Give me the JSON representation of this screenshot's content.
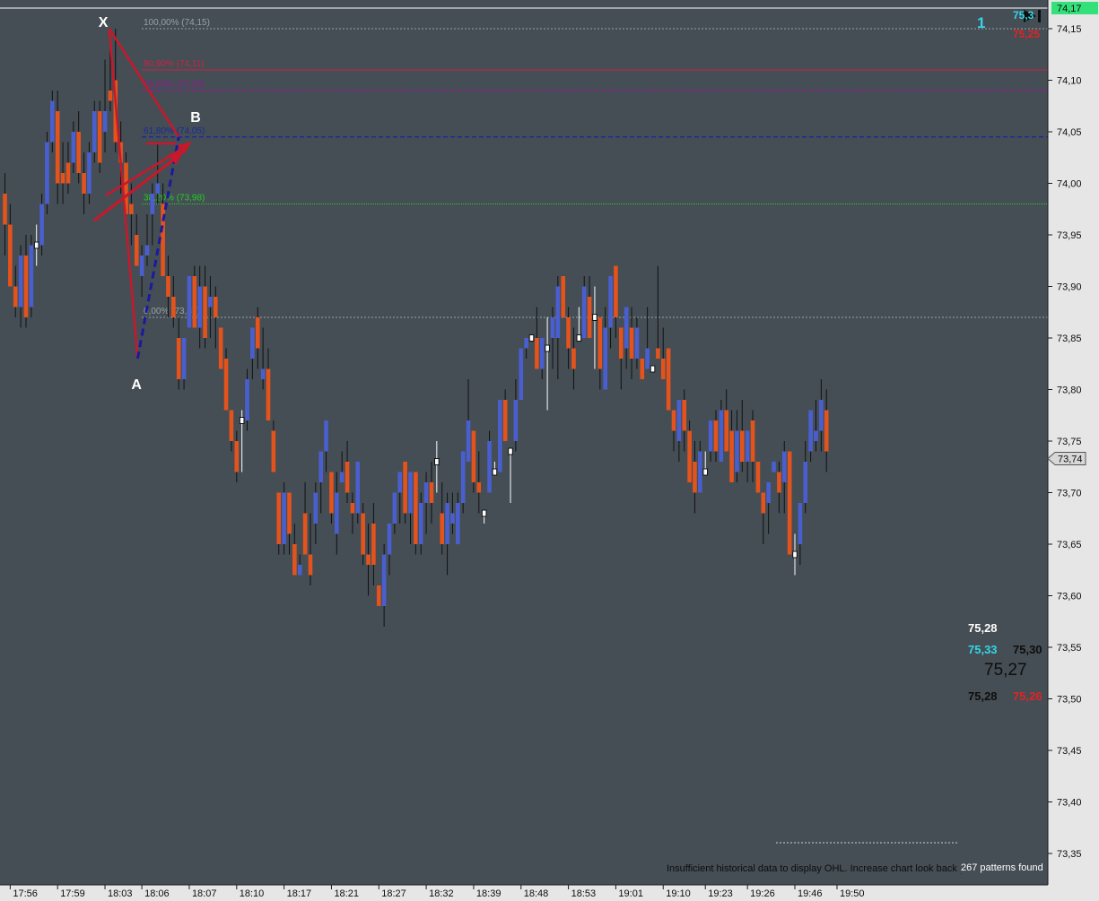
{
  "chart_data": {
    "type": "candlestick",
    "price_axis": {
      "min": 73.33,
      "max": 74.17,
      "ticks": [
        "74,15",
        "74,10",
        "74,05",
        "74,00",
        "73,95",
        "73,90",
        "73,85",
        "73,80",
        "73,75",
        "73,70",
        "73,65",
        "73,60",
        "73,55",
        "73,50",
        "73,45",
        "73,40",
        "73,35"
      ],
      "tick_values": [
        74.15,
        74.1,
        74.05,
        74.0,
        73.95,
        73.9,
        73.85,
        73.8,
        73.75,
        73.7,
        73.65,
        73.6,
        73.55,
        73.5,
        73.45,
        73.4,
        73.35
      ],
      "current_label": "74,17",
      "current_value": 74.17,
      "last_label": "73,74",
      "last_value": 73.74
    },
    "time_axis": {
      "ticks": [
        "17:56",
        "17:59",
        "18:03",
        "18:06",
        "18:07",
        "18:10",
        "18:17",
        "18:21",
        "18:27",
        "18:32",
        "18:39",
        "18:48",
        "18:53",
        "19:01",
        "19:10",
        "19:23",
        "19:26",
        "19:46",
        "19:50"
      ],
      "tick_bars": [
        1,
        10,
        19,
        26,
        35,
        44,
        53,
        62,
        71,
        80,
        89,
        98,
        107,
        116,
        125,
        133,
        141,
        150,
        158
      ]
    },
    "candles": [
      [
        73.99,
        74.01,
        73.93,
        73.96
      ],
      [
        73.96,
        73.98,
        73.9,
        73.9
      ],
      [
        73.9,
        73.92,
        73.87,
        73.88
      ],
      [
        73.88,
        73.94,
        73.86,
        73.93
      ],
      [
        73.93,
        73.95,
        73.86,
        73.87
      ],
      [
        73.88,
        73.95,
        73.87,
        73.94
      ],
      [
        73.94,
        73.96,
        73.92,
        73.94
      ],
      [
        73.94,
        73.99,
        73.93,
        73.98
      ],
      [
        73.98,
        74.05,
        73.97,
        74.04
      ],
      [
        74.04,
        74.09,
        74.03,
        74.08
      ],
      [
        74.07,
        74.09,
        73.98,
        74.0
      ],
      [
        74.01,
        74.04,
        73.98,
        74.0
      ],
      [
        74.02,
        74.04,
        73.99,
        74.0
      ],
      [
        74.02,
        74.06,
        74.01,
        74.05
      ],
      [
        74.05,
        74.07,
        74.0,
        74.01
      ],
      [
        74.01,
        74.03,
        73.97,
        73.99
      ],
      [
        73.99,
        74.04,
        73.98,
        74.03
      ],
      [
        74.03,
        74.08,
        74.02,
        74.07
      ],
      [
        74.07,
        74.08,
        74.01,
        74.02
      ],
      [
        74.05,
        74.12,
        74.03,
        74.07
      ],
      [
        74.09,
        74.14,
        74.07,
        74.08
      ],
      [
        74.1,
        74.15,
        74.03,
        74.04
      ],
      [
        74.04,
        74.06,
        73.99,
        74.02
      ],
      [
        74.02,
        74.03,
        73.96,
        73.97
      ],
      [
        73.98,
        74.0,
        73.94,
        73.97
      ],
      [
        73.95,
        73.97,
        73.92,
        73.92
      ],
      [
        73.91,
        73.94,
        73.89,
        73.93
      ],
      [
        73.93,
        73.97,
        73.92,
        73.94
      ],
      [
        73.97,
        74.0,
        73.94,
        73.99
      ],
      [
        73.99,
        74.04,
        73.98,
        74.0
      ],
      [
        73.98,
        74.0,
        73.91,
        73.91
      ],
      [
        73.91,
        73.93,
        73.87,
        73.89
      ],
      [
        73.89,
        73.91,
        73.86,
        73.87
      ],
      [
        73.85,
        73.87,
        73.8,
        73.81
      ],
      [
        73.81,
        73.85,
        73.8,
        73.85
      ],
      [
        73.86,
        73.91,
        73.86,
        73.91
      ],
      [
        73.91,
        73.92,
        73.86,
        73.86
      ],
      [
        73.86,
        73.92,
        73.84,
        73.9
      ],
      [
        73.9,
        73.92,
        73.84,
        73.85
      ],
      [
        73.88,
        73.91,
        73.85,
        73.89
      ],
      [
        73.89,
        73.9,
        73.84,
        73.87
      ],
      [
        73.86,
        73.86,
        73.82,
        73.82
      ],
      [
        73.83,
        73.84,
        73.78,
        73.78
      ],
      [
        73.78,
        73.78,
        73.74,
        73.75
      ],
      [
        73.75,
        73.76,
        73.71,
        73.72
      ],
      [
        73.77,
        73.78,
        73.72,
        73.77
      ],
      [
        73.77,
        73.82,
        73.76,
        73.81
      ],
      [
        73.83,
        73.86,
        73.81,
        73.86
      ],
      [
        73.87,
        73.88,
        73.82,
        73.84
      ],
      [
        73.81,
        73.86,
        73.8,
        73.82
      ],
      [
        73.82,
        73.84,
        73.77,
        73.77
      ],
      [
        73.76,
        73.77,
        73.72,
        73.72
      ],
      [
        73.7,
        73.7,
        73.64,
        73.65
      ],
      [
        73.65,
        73.71,
        73.64,
        73.7
      ],
      [
        73.7,
        73.7,
        73.64,
        73.66
      ],
      [
        73.65,
        73.67,
        73.62,
        73.62
      ],
      [
        73.62,
        73.64,
        73.62,
        73.63
      ],
      [
        73.68,
        73.71,
        73.64,
        73.64
      ],
      [
        73.64,
        73.68,
        73.61,
        73.62
      ],
      [
        73.67,
        73.71,
        73.65,
        73.7
      ],
      [
        73.71,
        73.74,
        73.68,
        73.74
      ],
      [
        73.74,
        73.77,
        73.72,
        73.77
      ],
      [
        73.72,
        73.72,
        73.67,
        73.68
      ],
      [
        73.66,
        73.72,
        73.64,
        73.7
      ],
      [
        73.71,
        73.74,
        73.71,
        73.72
      ],
      [
        73.73,
        73.75,
        73.69,
        73.7
      ],
      [
        73.69,
        73.7,
        73.66,
        73.68
      ],
      [
        73.68,
        73.73,
        73.67,
        73.73
      ],
      [
        73.68,
        73.69,
        73.63,
        73.64
      ],
      [
        73.64,
        73.67,
        73.6,
        73.63
      ],
      [
        73.67,
        73.69,
        73.61,
        73.63
      ],
      [
        73.61,
        73.61,
        73.59,
        73.59
      ],
      [
        73.59,
        73.65,
        73.57,
        73.64
      ],
      [
        73.64,
        73.67,
        73.62,
        73.67
      ],
      [
        73.67,
        73.7,
        73.66,
        73.7
      ],
      [
        73.7,
        73.72,
        73.67,
        73.72
      ],
      [
        73.73,
        73.73,
        73.67,
        73.68
      ],
      [
        73.68,
        73.72,
        73.65,
        73.72
      ],
      [
        73.72,
        73.72,
        73.64,
        73.65
      ],
      [
        73.65,
        73.7,
        73.64,
        73.69
      ],
      [
        73.69,
        73.72,
        73.66,
        73.71
      ],
      [
        73.71,
        73.73,
        73.67,
        73.69
      ],
      [
        73.73,
        73.75,
        73.7,
        73.73
      ],
      [
        73.68,
        73.71,
        73.64,
        73.65
      ],
      [
        73.65,
        73.7,
        73.62,
        73.69
      ],
      [
        73.67,
        73.7,
        73.66,
        73.68
      ],
      [
        73.65,
        73.7,
        73.65,
        73.69
      ],
      [
        73.69,
        73.74,
        73.68,
        73.74
      ],
      [
        73.73,
        73.81,
        73.76,
        73.77
      ],
      [
        73.76,
        73.76,
        73.7,
        73.71
      ],
      [
        73.71,
        73.74,
        73.68,
        73.7
      ],
      [
        73.68,
        73.68,
        73.67,
        73.68
      ],
      [
        73.7,
        73.76,
        73.7,
        73.75
      ],
      [
        73.72,
        73.72,
        73.73,
        73.72
      ],
      [
        73.72,
        73.79,
        73.72,
        73.79
      ],
      [
        73.79,
        73.8,
        73.75,
        73.75
      ],
      [
        73.74,
        73.74,
        73.69,
        73.74
      ],
      [
        73.75,
        73.81,
        73.74,
        73.79
      ],
      [
        73.79,
        73.84,
        73.79,
        73.84
      ],
      [
        73.84,
        73.85,
        73.83,
        73.85
      ],
      [
        73.85,
        73.85,
        73.85,
        73.85
      ],
      [
        73.85,
        73.88,
        73.82,
        73.82
      ],
      [
        73.82,
        73.83,
        73.81,
        73.85
      ],
      [
        73.84,
        73.87,
        73.78,
        73.84
      ],
      [
        73.85,
        73.88,
        73.82,
        73.87
      ],
      [
        73.85,
        73.91,
        73.81,
        73.9
      ],
      [
        73.91,
        73.91,
        73.89,
        73.87
      ],
      [
        73.87,
        73.88,
        73.82,
        73.84
      ],
      [
        73.84,
        73.86,
        73.8,
        73.82
      ],
      [
        73.85,
        73.88,
        73.85,
        73.85
      ],
      [
        73.85,
        73.91,
        73.86,
        73.9
      ],
      [
        73.89,
        73.91,
        73.85,
        73.85
      ],
      [
        73.87,
        73.9,
        73.82,
        73.87
      ],
      [
        73.87,
        73.87,
        73.8,
        73.82
      ],
      [
        73.8,
        73.88,
        73.8,
        73.86
      ],
      [
        73.86,
        73.91,
        73.84,
        73.91
      ],
      [
        73.92,
        73.92,
        73.85,
        73.87
      ],
      [
        73.86,
        73.86,
        73.8,
        73.83
      ],
      [
        73.84,
        73.88,
        73.82,
        73.88
      ],
      [
        73.86,
        73.88,
        73.81,
        73.83
      ],
      [
        73.83,
        73.87,
        73.82,
        73.86
      ],
      [
        73.83,
        73.83,
        73.81,
        73.81
      ],
      [
        73.82,
        73.88,
        73.82,
        73.84
      ],
      [
        73.82,
        73.83,
        73.83,
        73.82
      ],
      [
        73.84,
        73.92,
        73.83,
        73.83
      ],
      [
        73.83,
        73.86,
        73.81,
        73.81
      ],
      [
        73.84,
        73.84,
        73.78,
        73.78
      ],
      [
        73.78,
        73.78,
        73.74,
        73.76
      ],
      [
        73.75,
        73.79,
        73.73,
        73.79
      ],
      [
        73.79,
        73.8,
        73.74,
        73.76
      ],
      [
        73.76,
        73.77,
        73.71,
        73.71
      ],
      [
        73.73,
        73.75,
        73.68,
        73.7
      ],
      [
        73.7,
        73.75,
        73.7,
        73.74
      ],
      [
        73.72,
        73.74,
        73.72,
        73.72
      ],
      [
        73.74,
        73.77,
        73.73,
        73.77
      ],
      [
        73.77,
        73.78,
        73.73,
        73.74
      ],
      [
        73.73,
        73.79,
        73.73,
        73.78
      ],
      [
        73.78,
        73.8,
        73.74,
        73.74
      ],
      [
        73.76,
        73.78,
        73.71,
        73.71
      ],
      [
        73.72,
        73.78,
        73.71,
        73.76
      ],
      [
        73.76,
        73.79,
        73.72,
        73.73
      ],
      [
        73.73,
        73.76,
        73.71,
        73.76
      ],
      [
        73.77,
        73.78,
        73.71,
        73.73
      ],
      [
        73.73,
        73.73,
        73.7,
        73.7
      ],
      [
        73.7,
        73.7,
        73.65,
        73.68
      ],
      [
        73.69,
        73.71,
        73.66,
        73.71
      ],
      [
        73.72,
        73.73,
        73.72,
        73.73
      ],
      [
        73.72,
        73.73,
        73.68,
        73.7
      ],
      [
        73.71,
        73.75,
        73.68,
        73.74
      ],
      [
        73.74,
        73.74,
        73.65,
        73.64
      ],
      [
        73.64,
        73.66,
        73.62,
        73.64
      ],
      [
        73.65,
        73.69,
        73.63,
        73.69
      ],
      [
        73.69,
        73.75,
        73.68,
        73.73
      ],
      [
        73.74,
        73.78,
        73.73,
        73.78
      ],
      [
        73.75,
        73.79,
        73.74,
        73.76
      ],
      [
        73.76,
        73.81,
        73.74,
        73.79
      ],
      [
        73.78,
        73.8,
        73.72,
        73.74
      ]
    ],
    "fib_levels": [
      {
        "label": "100,00% (74,15)",
        "value": 74.15,
        "color": "#9aa0a6"
      },
      {
        "label": "90,90% (74,11)",
        "value": 74.11,
        "color": "#cc2244"
      },
      {
        "label": "78,60% (74,09)",
        "value": 74.09,
        "color": "#8a1f8a"
      },
      {
        "label": "61,80% (74,05)",
        "value": 74.045,
        "color": "#1a2a99"
      },
      {
        "label": "38,20% (73,98)",
        "value": 73.98,
        "color": "#22cc22"
      },
      {
        "label": "0,00% (73,87)",
        "value": 73.87,
        "color": "#9aa0a6"
      }
    ],
    "pattern_points": [
      {
        "label": "X",
        "bar": 19.8,
        "value": 74.15
      },
      {
        "label": "A",
        "bar": 25.2,
        "value": 73.83
      },
      {
        "label": "B",
        "bar": 33.0,
        "value": 74.045
      }
    ],
    "colors": {
      "up": "#4a5fcf",
      "down": "#e5531c",
      "background": "#454e55",
      "axis": "#e6e6e6"
    }
  },
  "overlay": {
    "count_label": "1",
    "top_right_top": "75,3",
    "top_right_red": "75,25",
    "info_top": "75,28",
    "info_cyan": "75,33",
    "info_right": "75,30",
    "info_big": "75,27",
    "info_black": "75,28",
    "info_red": "75,26",
    "ohl_notice": "Insufficient historical data to display OHL. Increase chart look back period.",
    "patterns_found": "267 patterns found"
  }
}
